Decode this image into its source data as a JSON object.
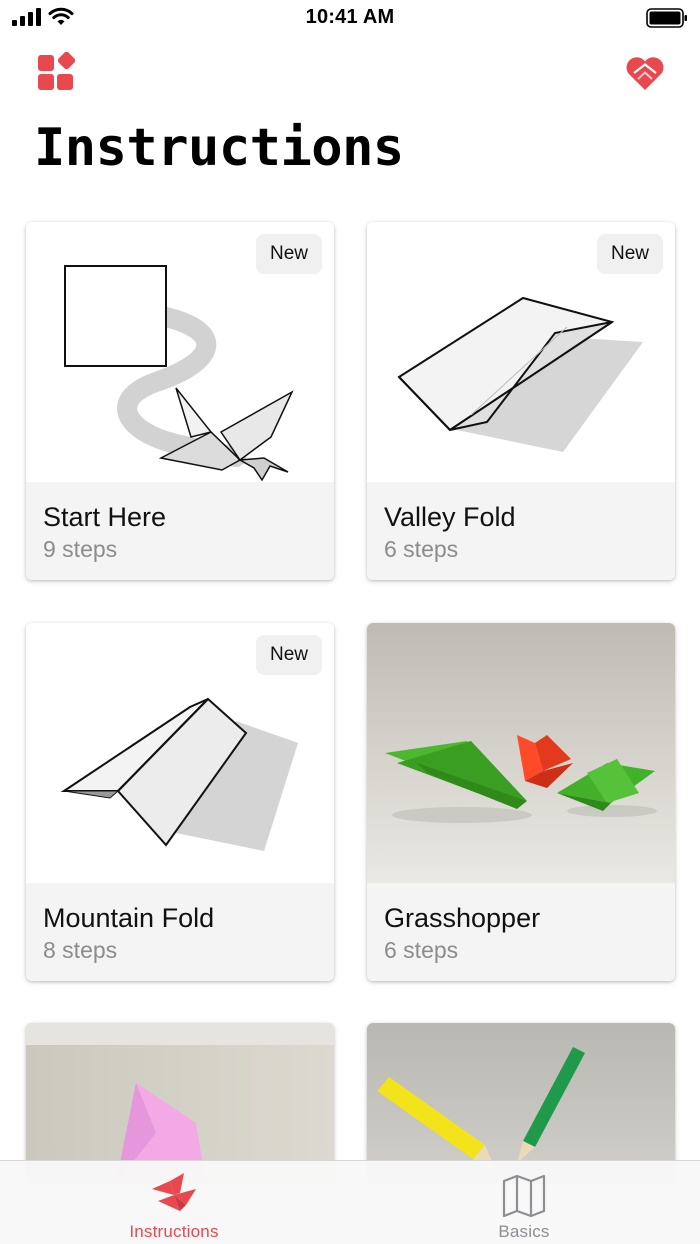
{
  "status_bar": {
    "time": "10:41 AM"
  },
  "header": {
    "title": "Instructions"
  },
  "icons": {
    "grid": "grid-icon",
    "favorite": "heart-icon"
  },
  "accent_color": "#e8484e",
  "cards": [
    {
      "title": "Start Here",
      "steps": "9 steps",
      "badge": "New",
      "image": "paper-to-crane-illustration"
    },
    {
      "title": "Valley Fold",
      "steps": "6 steps",
      "badge": "New",
      "image": "valley-fold-illustration"
    },
    {
      "title": "Mountain Fold",
      "steps": "8 steps",
      "badge": "New",
      "image": "mountain-fold-illustration"
    },
    {
      "title": "Grasshopper",
      "steps": "6 steps",
      "badge": "",
      "image": "grasshopper-photo"
    },
    {
      "image": "pink-origami-photo"
    },
    {
      "image": "pencils-photo"
    }
  ],
  "tab_bar": {
    "tabs": [
      {
        "label": "Instructions",
        "selected": true,
        "icon": "origami-crane-icon"
      },
      {
        "label": "Basics",
        "selected": false,
        "icon": "map-book-icon"
      }
    ]
  }
}
